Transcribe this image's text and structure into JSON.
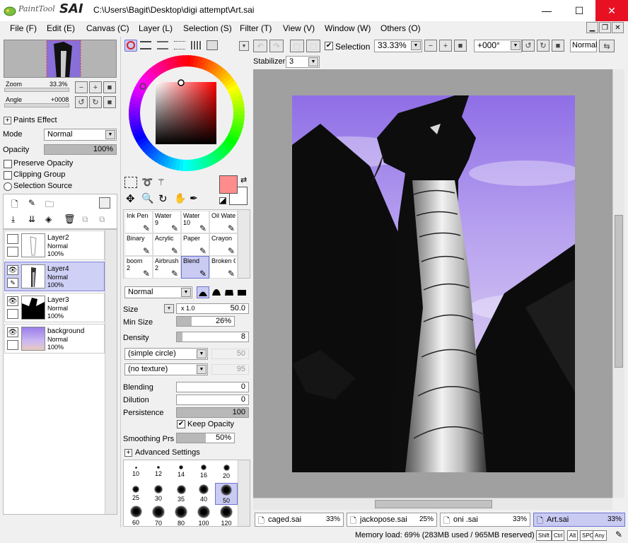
{
  "app": {
    "logo_text": "PaintTool",
    "logo_sai": "SAI",
    "title_path": "C:\\Users\\Bagit\\Desktop\\digi attempt\\Art.sai",
    "window_buttons": {
      "minimize": "—",
      "maximize": "☐",
      "close": "✕"
    }
  },
  "menu": [
    {
      "label": "File (F)"
    },
    {
      "label": "Edit (E)"
    },
    {
      "label": "Canvas (C)"
    },
    {
      "label": "Layer (L)"
    },
    {
      "label": "Selection (S)"
    },
    {
      "label": "Filter (T)"
    },
    {
      "label": "View (V)"
    },
    {
      "label": "Window (W)"
    },
    {
      "label": "Others (O)"
    }
  ],
  "navigator": {
    "zoom_label": "Zoom",
    "zoom_value": "33.3%",
    "angle_label": "Angle",
    "angle_value": "+0008"
  },
  "paints_effect": {
    "header": "Paints Effect",
    "mode_label": "Mode",
    "mode_value": "Normal",
    "opacity_label": "Opacity",
    "opacity_value": "100%",
    "opacity_fraction": 1.0,
    "preserve_opacity": "Preserve Opacity",
    "clipping_group": "Clipping Group",
    "selection_source": "Selection Source"
  },
  "layers": [
    {
      "name": "Layer2",
      "mode": "Normal",
      "opacity": "100%",
      "visible": false,
      "selected": false
    },
    {
      "name": "Layer4",
      "mode": "Normal",
      "opacity": "100%",
      "visible": true,
      "selected": true
    },
    {
      "name": "Layer3",
      "mode": "Normal",
      "opacity": "100%",
      "visible": true,
      "selected": false
    },
    {
      "name": "background",
      "mode": "Normal",
      "opacity": "100%",
      "visible": true,
      "selected": false
    }
  ],
  "toolbar": {
    "selection_label": "Selection",
    "zoom_value": "33.33%",
    "rotation_value": "+000°",
    "blend_mode": "Normal",
    "stabilizer_label": "Stabilizer",
    "stabilizer_value": "3"
  },
  "color": {
    "primary": "#ff8c8c",
    "secondary": "#ffffff",
    "hue_marker": "#ff0000"
  },
  "tools": [
    {
      "name": "Ink Pen",
      "size": ""
    },
    {
      "name": "Water",
      "size": "9"
    },
    {
      "name": "Water",
      "size": "10"
    },
    {
      "name": "Oil Wate",
      "size": ""
    },
    {
      "name": "Binary",
      "size": ""
    },
    {
      "name": "Acrylic",
      "size": ""
    },
    {
      "name": "Paper",
      "size": ""
    },
    {
      "name": "Crayon",
      "size": ""
    },
    {
      "name": "boom",
      "size": "2"
    },
    {
      "name": "Airbrush",
      "size": "2"
    },
    {
      "name": "Blend",
      "size": ""
    },
    {
      "name": "Broken Chalk",
      "size": ""
    }
  ],
  "brush_settings": {
    "blend_mode": "Normal",
    "size_label": "Size",
    "size_multiplier": "x 1.0",
    "size_value": "50.0",
    "min_size_label": "Min Size",
    "min_size_value": "26%",
    "min_size_fraction": 0.26,
    "density_label": "Density",
    "density_value": "8",
    "density_fraction": 0.08,
    "shape": "(simple circle)",
    "shape_value": "50",
    "texture": "(no texture)",
    "texture_value": "95",
    "blending_label": "Blending",
    "blending_value": "0",
    "dilution_label": "Dilution",
    "dilution_value": "0",
    "persistence_label": "Persistence",
    "persistence_value": "100",
    "persistence_fraction": 1.0,
    "keep_opacity": "Keep Opacity",
    "smoothing_label": "Smoothing Prs",
    "smoothing_value": "50%",
    "smoothing_fraction": 0.5,
    "advanced": "Advanced Settings"
  },
  "brush_sizes": [
    "10",
    "12",
    "14",
    "16",
    "20",
    "25",
    "30",
    "35",
    "40",
    "50",
    "60",
    "70",
    "80",
    "100",
    "120"
  ],
  "tabs": [
    {
      "name": "caged.sai",
      "zoom": "33%",
      "selected": false
    },
    {
      "name": "jackopose.sai",
      "zoom": "25%",
      "selected": false
    },
    {
      "name": "oni .sai",
      "zoom": "33%",
      "selected": false
    },
    {
      "name": "Art.sai",
      "zoom": "33%",
      "selected": true
    }
  ],
  "status": {
    "memory": "Memory load: 69% (283MB used / 965MB reserved)",
    "keys": [
      "Shift",
      "Ctrl",
      "Alt",
      "SPC",
      "Any"
    ]
  }
}
